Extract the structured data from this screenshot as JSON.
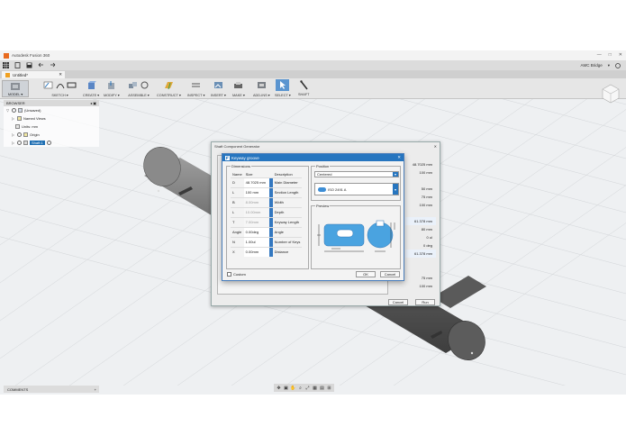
{
  "window": {
    "title": "Autodesk Fusion 360",
    "controls": [
      "—",
      "□",
      "✕"
    ]
  },
  "qat": {
    "user": "AMC Bridge",
    "user_arrow": "▾"
  },
  "doc_tab": {
    "name": "Untitled*",
    "close": "✕"
  },
  "ribbon": {
    "workspace": "MODEL ▾",
    "groups": [
      "SKETCH ▾",
      "CREATE ▾",
      "MODIFY ▾",
      "ASSEMBLE ▾",
      "CONSTRUCT ▾",
      "INSPECT ▾",
      "INSERT ▾",
      "MAKE ▾",
      "ADD-INS ▾",
      "SELECT ▾",
      "SHAFT"
    ]
  },
  "browser": {
    "header": "BROWSER",
    "items": [
      {
        "label": "(Unsaved)",
        "arrow": "▽"
      },
      {
        "label": "Named Views",
        "arrow": "▷"
      },
      {
        "label": "Units: mm",
        "arrow": ""
      },
      {
        "label": "Origin",
        "arrow": "▷"
      },
      {
        "label": "Shaft:1",
        "arrow": "▷"
      }
    ]
  },
  "comments": {
    "label": "COMMENTS",
    "add": "+"
  },
  "shaft_generator": {
    "title": "Shaft Component Generator",
    "right_values": [
      "48.7025 mm",
      "100 mm",
      "",
      "50 mm",
      "75 mm",
      "100 mm",
      "",
      "61.378 mm",
      "80 mm",
      "0 ul",
      "0 deg",
      "61.378 mm",
      "",
      "",
      "75 mm",
      "100 mm"
    ],
    "cancel": "Cancel",
    "run": "Run"
  },
  "keyway": {
    "title": "Keyway groove",
    "dimensions_title": "Dimensions",
    "columns": [
      "Name",
      "Size",
      "Description"
    ],
    "rows": [
      {
        "name": "D",
        "size": "48.7025 mm",
        "desc": "Main Diameter",
        "disabled": false
      },
      {
        "name": "L",
        "size": "100 mm",
        "desc": "Section Length",
        "disabled": false
      },
      {
        "name": "B",
        "size": "8.00mm",
        "desc": "Width",
        "disabled": true
      },
      {
        "name": "L",
        "size": "10.00mm",
        "desc": "Depth",
        "disabled": true
      },
      {
        "name": "T",
        "size": "7.00mm",
        "desc": "Keyway Length",
        "disabled": true
      },
      {
        "name": "Angle",
        "size": "0.00deg",
        "desc": "Angle",
        "disabled": false
      },
      {
        "name": "N",
        "size": "1.00ul",
        "desc": "Number of Keys",
        "disabled": false
      },
      {
        "name": "X",
        "size": "0.00mm",
        "desc": "Distance",
        "disabled": false
      }
    ],
    "position_title": "Position",
    "position_value": "Centered",
    "standard_value": "ISO 2491 A",
    "preview_title": "Preview",
    "custom_label": "Custom",
    "ok": "OK",
    "cancel": "Cancel"
  },
  "navbar": [
    "✥",
    "▣",
    "✋",
    "⌕",
    "⤢",
    "▦",
    "▤",
    "⊞"
  ],
  "colors": {
    "accent": "#2675bf",
    "preview_blue": "#4aa3e0",
    "shaft_dark": "#5a5a5a"
  }
}
